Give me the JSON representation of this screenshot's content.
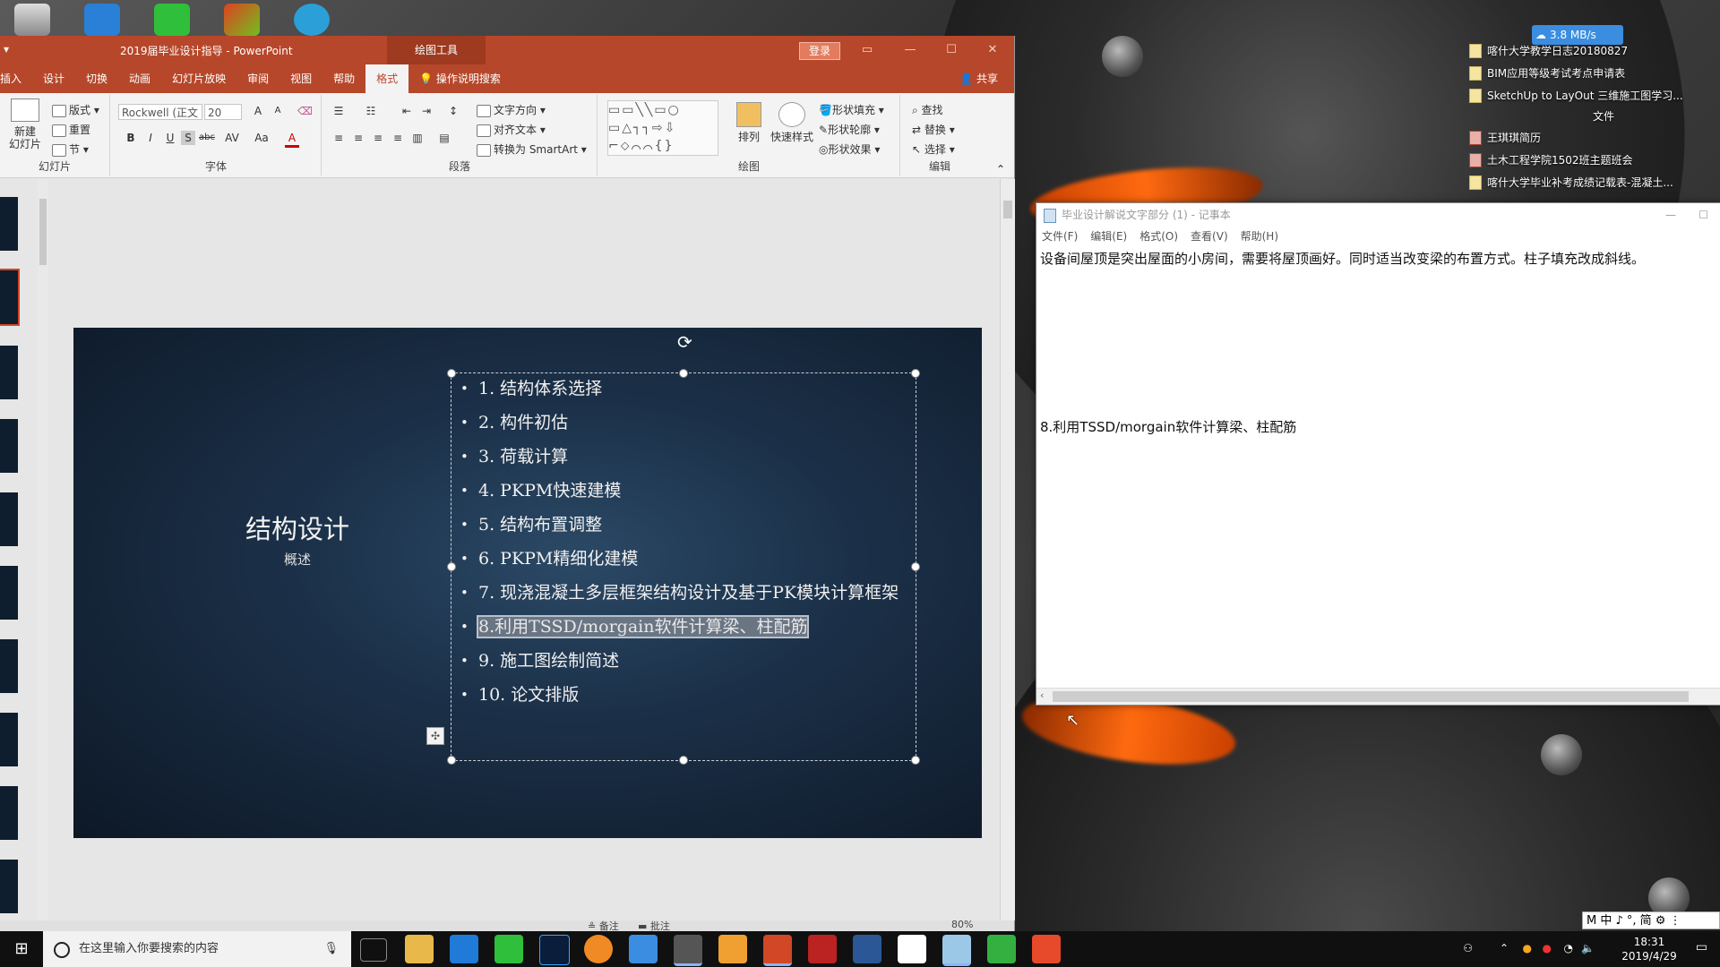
{
  "desktop": {
    "net_speed": "3.8 MB/s",
    "files_top": [
      "喀什大学教学日志20180827",
      "BIM应用等级考试考点申请表",
      "SketchUp to LayOut 三维施工图学习..."
    ],
    "section_label": "文件",
    "files_bottom": [
      "王琪琪简历",
      "土木工程学院1502班主题班会",
      "喀什大学毕业补考成绩记载表-混凝土..."
    ]
  },
  "powerpoint": {
    "title": "2019届毕业设计指导 - PowerPoint",
    "drawing_tools": "绘图工具",
    "login": "登录",
    "tabs": [
      "插入",
      "设计",
      "切换",
      "动画",
      "幻灯片放映",
      "审阅",
      "视图",
      "帮助",
      "格式"
    ],
    "tell_me": "操作说明搜索",
    "share": "共享",
    "ribbon": {
      "new_slide": "新建\n幻灯片",
      "layout": "版式",
      "reset": "重置",
      "section": "节",
      "group_slides": "幻灯片",
      "font_name": "Rockwell (正文",
      "font_size": "20",
      "group_font": "字体",
      "text_direction": "文字方向",
      "align_text": "对齐文本",
      "smartart": "转换为 SmartArt",
      "group_paragraph": "段落",
      "arrange": "排列",
      "quick_styles": "快速样式",
      "shape_fill": "形状填充",
      "shape_outline": "形状轮廓",
      "shape_effects": "形状效果",
      "group_drawing": "绘图",
      "find": "查找",
      "replace": "替换",
      "select": "选择",
      "group_editing": "编辑"
    },
    "slide": {
      "title": "结构设计",
      "subtitle": "概述",
      "items": [
        "1. 结构体系选择",
        "2. 构件初估",
        "3. 荷载计算",
        "4.  PKPM快速建模",
        "5. 结构布置调整",
        "6. PKPM精细化建模",
        "7. 现浇混凝土多层框架结构设计及基于PK模块计算框架",
        "8.利用TSSD/morgain软件计算梁、柱配筋",
        "9. 施工图绘制简述",
        "10. 论文排版"
      ]
    },
    "status": {
      "notes": "备注",
      "comments": "批注",
      "zoom": "80%"
    }
  },
  "notepad": {
    "title": "毕业设计解说文字部分 (1) - 记事本",
    "menu": [
      "文件(F)",
      "编辑(E)",
      "格式(O)",
      "查看(V)",
      "帮助(H)"
    ],
    "line1": "设备间屋顶是突出屋面的小房间，需要将屋顶画好。同时适当改变梁的布置方式。柱子填充改成斜线。",
    "line2": "8.利用TSSD/morgain软件计算梁、柱配筋"
  },
  "taskbar": {
    "search_placeholder": "在这里输入你要搜索的内容",
    "time": "18:31",
    "date": "2019/4/29",
    "ime": "M 中 ♪ °, 简 ⚙ ⋮"
  }
}
